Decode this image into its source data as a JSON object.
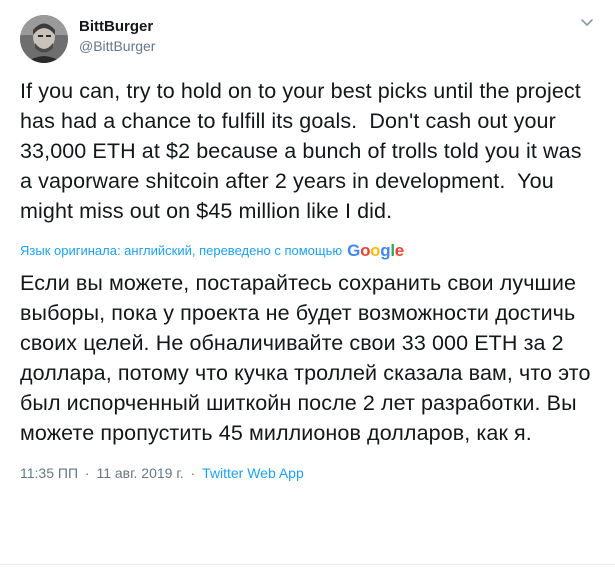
{
  "user": {
    "display_name": "BittBurger",
    "handle": "@BittBurger"
  },
  "icons": {
    "more": "chevron-down-icon",
    "avatar": "avatar"
  },
  "tweet": {
    "text": "If you can, try to hold on to your best picks until the project has had a chance to fulfill its goals.  Don't cash out your 33,000 ETH at $2 because a bunch of trolls told you it was a vaporware shitcoin after 2 years in development.  You might miss out on $45 million like I did."
  },
  "translation": {
    "label": "Язык оригинала: английский, переведено с помощью",
    "provider": "Google",
    "text": "Если вы можете, постарайтесь сохранить свои лучшие выборы, пока у проекта не будет возможности достичь своих целей. Не обналичивайте свои 33 000 ETH за 2 доллара, потому что кучка троллей сказала вам, что это был испорченный шиткойн после 2 лет разработки. Вы можете пропустить 45 миллионов долларов, как я."
  },
  "meta": {
    "time": "11:35 ПП",
    "separator": "·",
    "date": "11 авг. 2019 г.",
    "source": "Twitter Web App"
  },
  "colors": {
    "link": "#1da1f2",
    "secondary": "#657786",
    "text": "#14171a",
    "google_blue": "#4285f4",
    "google_red": "#ea4335",
    "google_yellow": "#fbbc05",
    "google_green": "#34a853"
  }
}
